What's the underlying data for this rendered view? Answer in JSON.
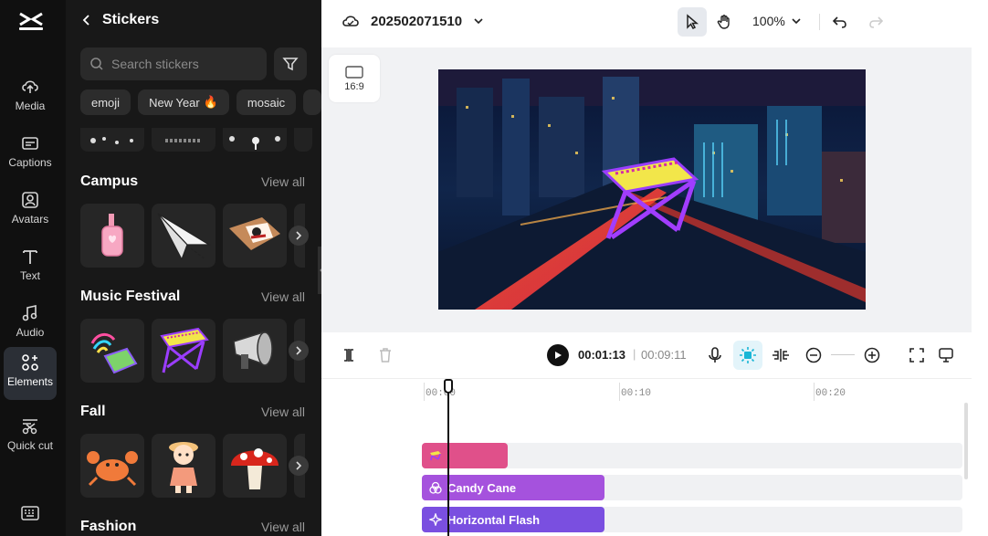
{
  "rail": {
    "items": [
      {
        "label": "Media",
        "icon": "cloud-upload-icon"
      },
      {
        "label": "Captions",
        "icon": "captions-icon"
      },
      {
        "label": "Avatars",
        "icon": "avatar-icon"
      },
      {
        "label": "Text",
        "icon": "text-icon"
      },
      {
        "label": "Audio",
        "icon": "music-note-icon"
      },
      {
        "label": "Elements",
        "icon": "elements-icon",
        "active": true
      },
      {
        "label": "Quick cut",
        "icon": "scissors-icon"
      }
    ]
  },
  "panel": {
    "title": "Stickers",
    "search_placeholder": "Search stickers",
    "chips": [
      "emoji",
      "New Year",
      "mosaic"
    ],
    "sections": [
      {
        "title": "Campus",
        "view_all": "View all"
      },
      {
        "title": "Music Festival",
        "view_all": "View all"
      },
      {
        "title": "Fall",
        "view_all": "View all"
      },
      {
        "title": "Fashion",
        "view_all": "View all"
      }
    ]
  },
  "topbar": {
    "project_name": "202502071510",
    "zoom": "100%"
  },
  "canvas": {
    "aspect_label": "16:9"
  },
  "player": {
    "current_time": "00:01:13",
    "separator": "|",
    "total_time": "00:09:11"
  },
  "timeline": {
    "ruler_labels": [
      "00:00",
      "00:10",
      "00:20"
    ],
    "clips": [
      {
        "label": "",
        "color": "#e0508a"
      },
      {
        "label": "Candy Cane",
        "color": "#a552dd"
      },
      {
        "label": "Horizontal Flash",
        "color": "#7a4fe0"
      }
    ]
  },
  "colors": {
    "rail_bg": "#101010",
    "panel_bg": "#181818",
    "accent_cyan": "#19b6d6"
  }
}
